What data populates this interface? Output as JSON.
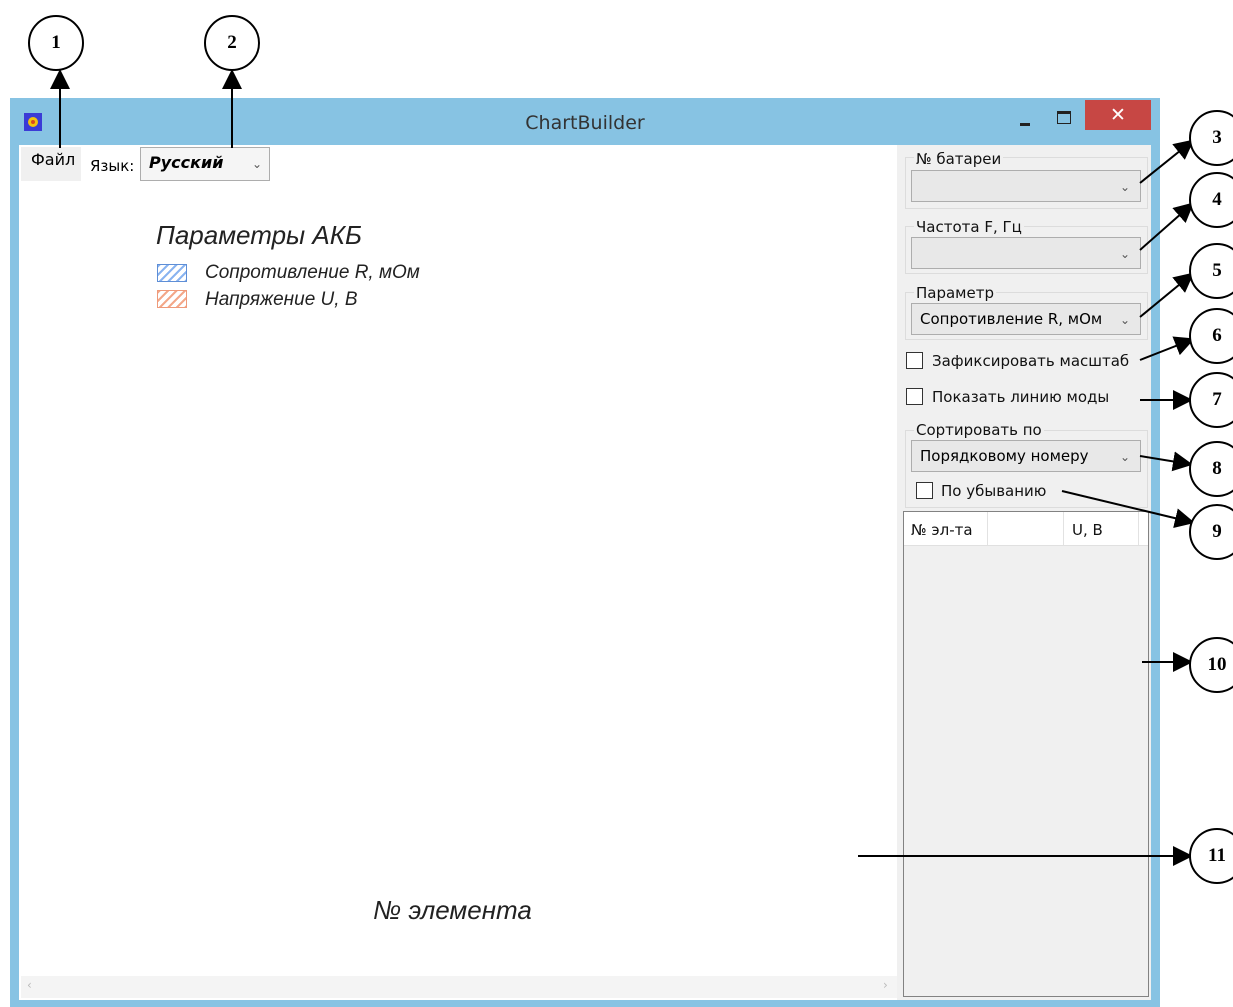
{
  "window": {
    "title": "ChartBuilder",
    "close_glyph": "✕"
  },
  "menu": {
    "file": "Файл"
  },
  "language": {
    "label": "Язык:",
    "value": "Русский"
  },
  "chart": {
    "legend_title": "Параметры АКБ",
    "legend": [
      {
        "name": "Сопротивление R, мОм",
        "color": "#8ab4f0"
      },
      {
        "name": "Напряжение U, В",
        "color": "#f3a88a"
      }
    ],
    "xlabel": "№ элемента"
  },
  "panel": {
    "battery_label": "№ батареи",
    "battery_value": "",
    "freq_label": "Частота F, Гц",
    "freq_value": "",
    "param_label": "Параметр",
    "param_value": "Сопротивление R, мОм",
    "fix_scale_label": "Зафиксировать масштаб",
    "fix_scale_checked": false,
    "show_mode_label": "Показать линию моды",
    "show_mode_checked": false,
    "sort_label": "Сортировать по",
    "sort_value": "Порядковому номеру",
    "descending_label": "По убыванию",
    "descending_checked": false,
    "table_columns": [
      "№ эл-та",
      "",
      "U, В"
    ]
  },
  "annotations": [
    "1",
    "2",
    "3",
    "4",
    "5",
    "6",
    "7",
    "8",
    "9",
    "10",
    "11"
  ]
}
